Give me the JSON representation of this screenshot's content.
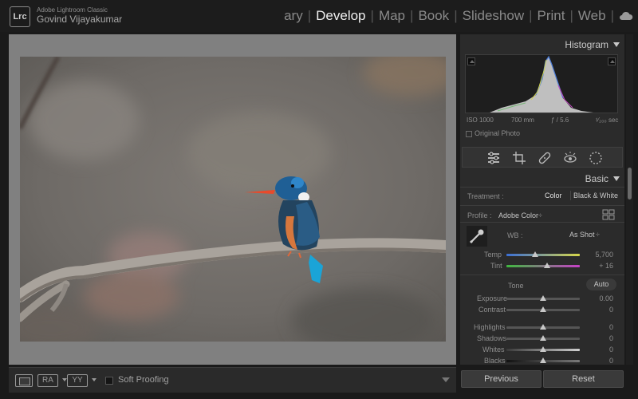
{
  "app": {
    "product": "Adobe Lightroom Classic",
    "user": "Govind Vijayakumar",
    "badge": "Lrc"
  },
  "modules": [
    {
      "label": "ary",
      "active": false
    },
    {
      "label": "Develop",
      "active": true
    },
    {
      "label": "Map",
      "active": false
    },
    {
      "label": "Book",
      "active": false
    },
    {
      "label": "Slideshow",
      "active": false
    },
    {
      "label": "Print",
      "active": false
    },
    {
      "label": "Web",
      "active": false
    }
  ],
  "toolbar": {
    "view_ra": "RA",
    "view_yy": "YY",
    "soft_proofing": "Soft Proofing"
  },
  "histogram": {
    "title": "Histogram",
    "iso": "ISO 1000",
    "focal": "700 mm",
    "aperture": "ƒ / 5.6",
    "shutter": "¹⁄₂₀₀ sec",
    "original_photo": "Original Photo"
  },
  "basic": {
    "title": "Basic",
    "treatment_label": "Treatment :",
    "treatment_color": "Color",
    "treatment_bw": "Black & White",
    "profile_label": "Profile :",
    "profile_value": "Adobe Color",
    "wb_label": "WB :",
    "wb_value": "As Shot",
    "temp_label": "Temp",
    "temp_value": "5,700",
    "tint_label": "Tint",
    "tint_value": "+ 16",
    "tone_label": "Tone",
    "auto_label": "Auto",
    "exposure_label": "Exposure",
    "exposure_value": "0.00",
    "contrast_label": "Contrast",
    "contrast_value": "0",
    "highlights_label": "Highlights",
    "highlights_value": "0",
    "shadows_label": "Shadows",
    "shadows_value": "0",
    "whites_label": "Whites",
    "whites_value": "0",
    "blacks_label": "Blacks",
    "blacks_value": "0"
  },
  "buttons": {
    "previous": "Previous",
    "reset": "Reset"
  },
  "colors": {
    "accent": "#f0f0f0",
    "panel": "#2b2b2b",
    "canvas": "#808080"
  }
}
